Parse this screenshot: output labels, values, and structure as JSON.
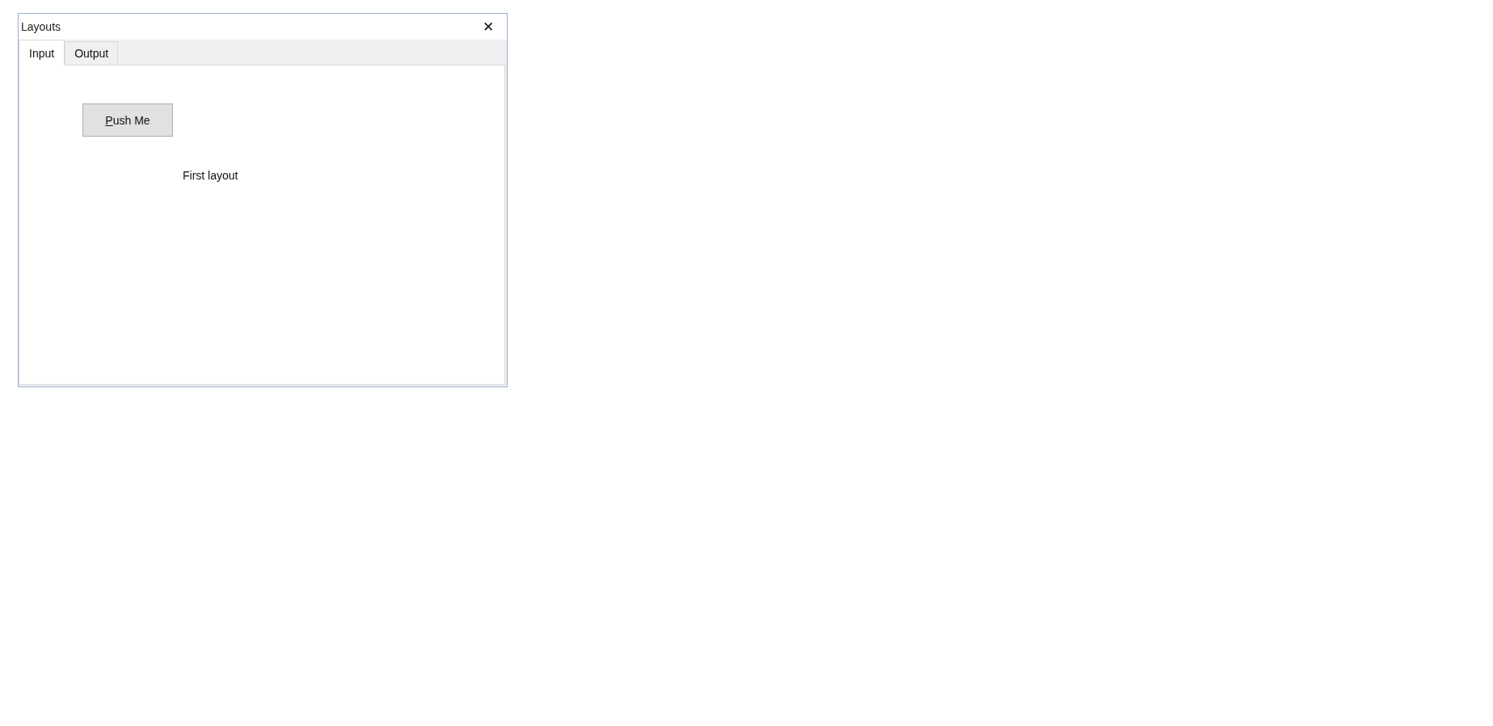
{
  "window": {
    "title": "Layouts",
    "close_glyph": "✕"
  },
  "tabs": [
    {
      "label": "Input",
      "selected": true
    },
    {
      "label": "Output",
      "selected": false
    }
  ],
  "panel": {
    "button": {
      "label": "Push Me",
      "underline_first": true
    },
    "label": "First layout"
  }
}
